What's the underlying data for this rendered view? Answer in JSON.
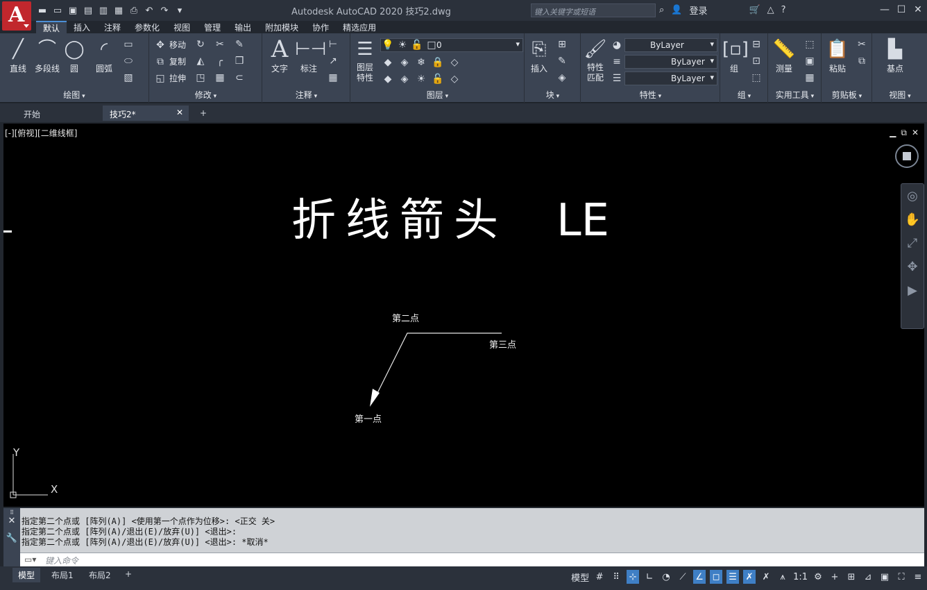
{
  "window": {
    "title": "Autodesk AutoCAD 2020    技巧2.dwg",
    "search_placeholder": "键入关键字或短语",
    "login_label": "登录",
    "app_logo": "A"
  },
  "ribbon_tabs": [
    "默认",
    "插入",
    "注释",
    "参数化",
    "视图",
    "管理",
    "输出",
    "附加模块",
    "协作",
    "精选应用"
  ],
  "panels": {
    "draw": {
      "label": "绘图",
      "line": "直线",
      "polyline": "多段线",
      "circle": "圆",
      "arc": "圆弧"
    },
    "modify": {
      "label": "修改",
      "move": "移动",
      "copy": "复制",
      "stretch": "拉伸"
    },
    "annotation": {
      "label": "注释",
      "text": "文字",
      "dimension": "标注"
    },
    "layers": {
      "label": "图层",
      "layer_props": "图层\n特性",
      "current_layer": "0"
    },
    "block": {
      "label": "块",
      "insert": "插入"
    },
    "properties": {
      "label": "特性",
      "match": "特性\n匹配",
      "color": "ByLayer",
      "linetype": "ByLayer",
      "lineweight": "ByLayer"
    },
    "groups": {
      "label": "组",
      "group": "组"
    },
    "utilities": {
      "label": "实用工具",
      "measure": "测量"
    },
    "clipboard": {
      "label": "剪贴板",
      "paste": "粘贴"
    },
    "view": {
      "label": "视图",
      "base": "基点"
    }
  },
  "doc_tabs": {
    "start": "开始",
    "drawing": "技巧2*"
  },
  "viewport": {
    "view_label": "[-][俯视][二维线框]",
    "title_cn": "折线箭头",
    "title_en": "LE",
    "point1": "第一点",
    "point2": "第二点",
    "point3": "第三点",
    "axis_x": "X",
    "axis_y": "Y"
  },
  "command": {
    "history": [
      "指定第二个点或 [阵列(A)] <使用第一个点作为位移>: <正交 关>",
      "指定第二个点或 [阵列(A)/退出(E)/放弃(U)] <退出>:",
      "指定第二个点或 [阵列(A)/退出(E)/放弃(U)] <退出>: *取消*"
    ],
    "placeholder": "键入命令"
  },
  "layout_tabs": [
    "模型",
    "布局1",
    "布局2"
  ],
  "status": {
    "model": "模型",
    "scale": "1:1"
  }
}
